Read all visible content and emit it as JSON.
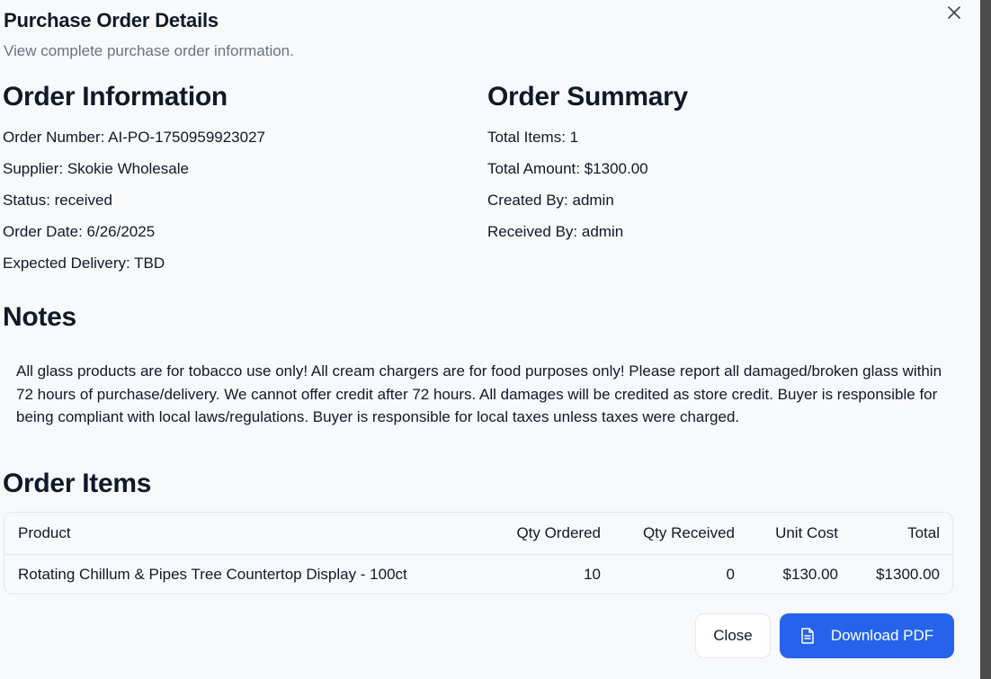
{
  "dialog": {
    "title": "Purchase Order Details",
    "subtitle": "View complete purchase order information."
  },
  "order_info": {
    "heading": "Order Information",
    "order_number": "Order Number: AI-PO-1750959923027",
    "supplier": "Supplier: Skokie Wholesale",
    "status": "Status: received",
    "order_date": "Order Date: 6/26/2025",
    "expected_delivery": "Expected Delivery: TBD"
  },
  "order_summary": {
    "heading": "Order Summary",
    "total_items": "Total Items: 1",
    "total_amount": "Total Amount: $1300.00",
    "created_by": "Created By: admin",
    "received_by": "Received By: admin"
  },
  "notes": {
    "heading": "Notes",
    "text": "All glass products are for tobacco use only! All cream chargers are for food purposes only! Please report all damaged/broken glass within 72 hours of purchase/delivery. We cannot offer credit after 72 hours. All damages will be credited as store credit. Buyer is responsible for being compliant with local laws/regulations. Buyer is responsible for local taxes unless taxes were charged."
  },
  "items": {
    "heading": "Order Items",
    "columns": {
      "product": "Product",
      "qty_ordered": "Qty Ordered",
      "qty_received": "Qty Received",
      "unit_cost": "Unit Cost",
      "total": "Total"
    },
    "rows": [
      {
        "product": "Rotating Chillum & Pipes Tree Countertop Display - 100ct",
        "qty_ordered": "10",
        "qty_received": "0",
        "unit_cost": "$130.00",
        "total": "$1300.00"
      }
    ]
  },
  "actions": {
    "close_label": "Close",
    "download_label": "Download PDF"
  },
  "icons": {
    "close": "close-icon",
    "download": "document-icon"
  },
  "colors": {
    "primary": "#2563eb",
    "background": "#f8f9fb",
    "muted_text": "#6b7280"
  }
}
